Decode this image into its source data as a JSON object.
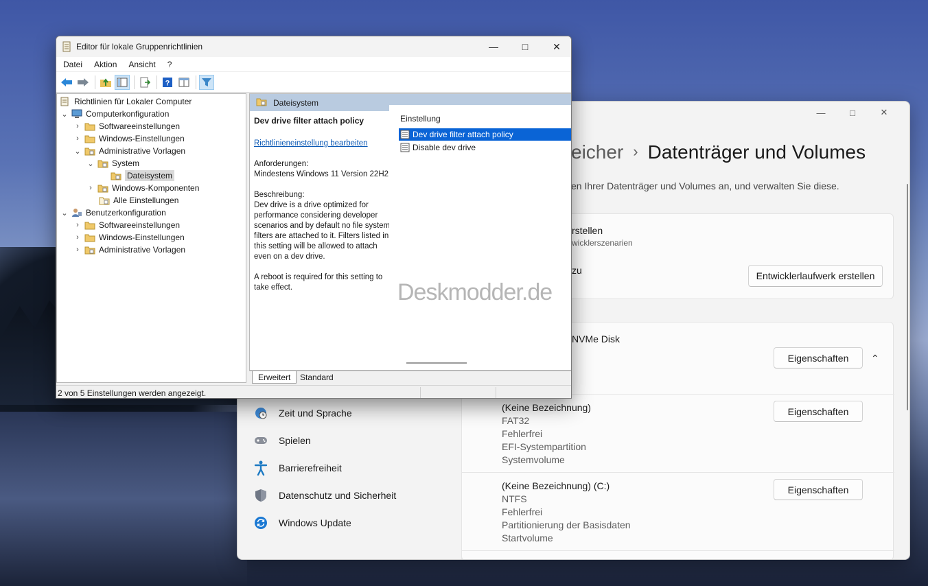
{
  "settings": {
    "breadcrumb_parent": "eicher",
    "title": "Datenträger und Volumes",
    "subtitle": "en Ihrer Datenträger und Volumes an, und verwalten Sie diese.",
    "card1": {
      "line1": "rstellen",
      "line2": "wicklerszenarien",
      "line3": "zu",
      "button": "Entwicklerlaufwerk erstellen"
    },
    "disk_name": "NVMe Disk",
    "disk_button": "Eigenschaften",
    "partitions": [
      {
        "name": "(Keine Bezeichnung)",
        "fs": "FAT32",
        "state": "Fehlerfrei",
        "type": "EFI-Systempartition",
        "role": "Systemvolume",
        "button": "Eigenschaften"
      },
      {
        "name": "(Keine Bezeichnung) (C:)",
        "fs": "NTFS",
        "state": "Fehlerfrei",
        "type": "Partitionierung der Basisdaten",
        "role": "Startvolume",
        "button": "Eigenschaften"
      }
    ],
    "nav": [
      {
        "label": "Zeit und Sprache",
        "icon": "globe-clock-icon"
      },
      {
        "label": "Spielen",
        "icon": "gamepad-icon"
      },
      {
        "label": "Barrierefreiheit",
        "icon": "accessibility-icon"
      },
      {
        "label": "Datenschutz und Sicherheit",
        "icon": "shield-icon"
      },
      {
        "label": "Windows Update",
        "icon": "sync-icon"
      }
    ]
  },
  "gpedit": {
    "title": "Editor für lokale Gruppenrichtlinien",
    "menu": [
      "Datei",
      "Aktion",
      "Ansicht",
      "?"
    ],
    "tree": {
      "root": "Richtlinien für Lokaler Computer",
      "computer": "Computerkonfiguration",
      "c_software": "Softwareeinstellungen",
      "c_windows": "Windows-Einstellungen",
      "c_admin": "Administrative Vorlagen",
      "system": "System",
      "dateisystem": "Dateisystem",
      "winkomp": "Windows-Komponenten",
      "alle": "Alle Einstellungen",
      "user": "Benutzerkonfiguration",
      "u_software": "Softwareeinstellungen",
      "u_windows": "Windows-Einstellungen",
      "u_admin": "Administrative Vorlagen"
    },
    "header": "Dateisystem",
    "description": {
      "title": "Dev drive filter attach policy",
      "link": "Richtlinieneinstellung bearbeiten",
      "req_label": "Anforderungen:",
      "req_value": "Mindestens Windows 11 Version 22H2",
      "desc_label": "Beschreibung:",
      "desc_text": "Dev drive is a drive optimized for performance considering developer scenarios and by default no file system filters are attached to it. Filters listed in this setting will be allowed to attach even on a dev drive.",
      "note": "A reboot is required for this setting to take effect."
    },
    "list_header": "Einstellung",
    "items": [
      "Dev drive filter attach policy",
      "Disable dev drive"
    ],
    "watermark": "Deskmodder.de",
    "tabs": [
      "Erweitert",
      "Standard"
    ],
    "status": "2 von 5 Einstellungen werden angezeigt."
  }
}
